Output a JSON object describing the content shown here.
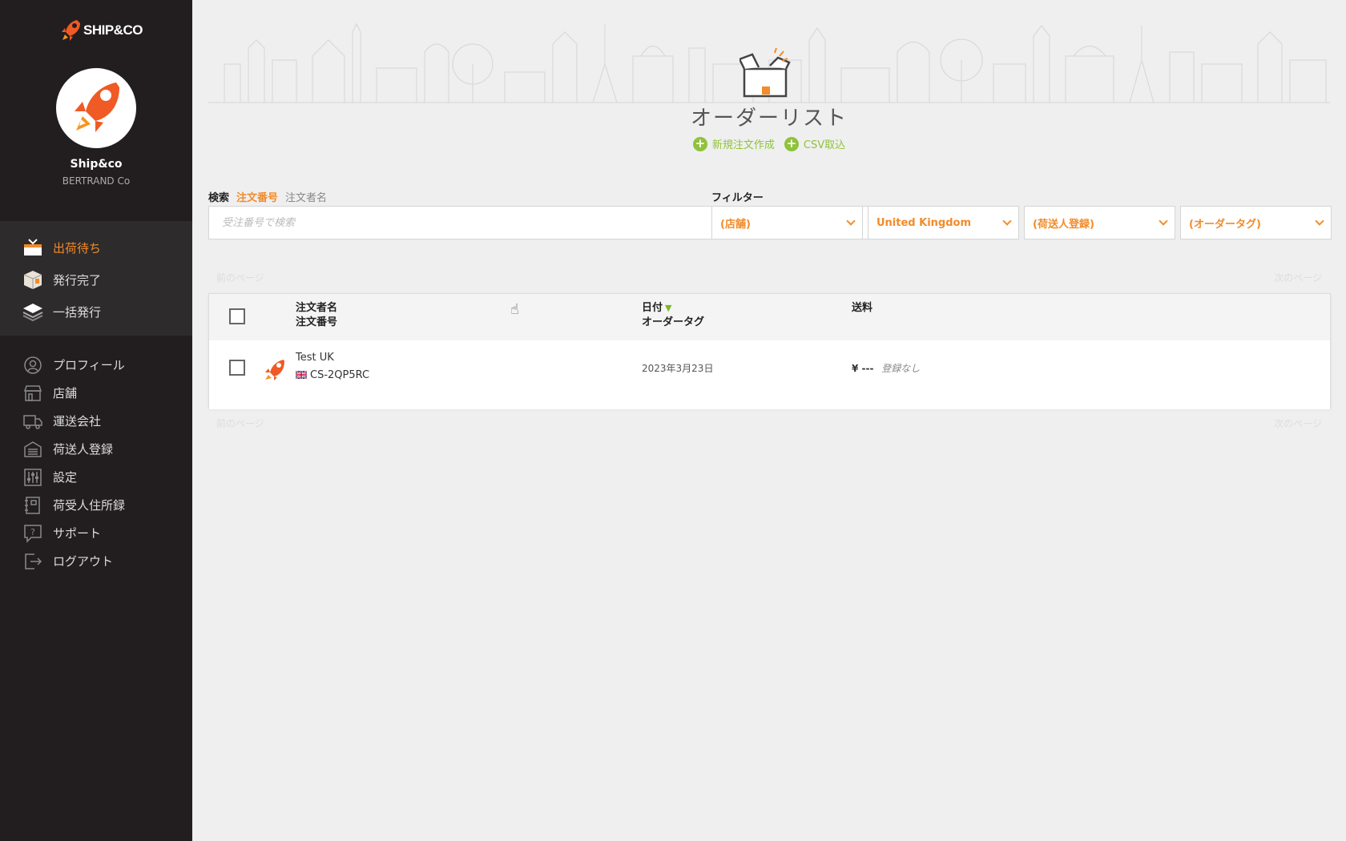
{
  "sidebar": {
    "logo_text": "SHIP&CO",
    "company_name": "Ship&co",
    "company_sub": "BERTRAND Co",
    "main_items": [
      {
        "label": "出荷待ち",
        "icon": "cart-icon",
        "active": true
      },
      {
        "label": "発行完了",
        "icon": "package-icon",
        "active": false
      },
      {
        "label": "一括発行",
        "icon": "stack-icon",
        "active": false
      }
    ],
    "secondary_items": [
      {
        "label": "プロフィール",
        "icon": "user-icon"
      },
      {
        "label": "店舗",
        "icon": "store-icon"
      },
      {
        "label": "運送会社",
        "icon": "truck-icon"
      },
      {
        "label": "荷送人登録",
        "icon": "warehouse-icon"
      },
      {
        "label": "設定",
        "icon": "sliders-icon"
      },
      {
        "label": "荷受人住所録",
        "icon": "address-book-icon"
      },
      {
        "label": "サポート",
        "icon": "help-icon"
      },
      {
        "label": "ログアウト",
        "icon": "logout-icon"
      }
    ]
  },
  "header": {
    "title": "オーダーリスト",
    "new_order": "新規注文作成",
    "csv_import": "CSV取込"
  },
  "search": {
    "label": "検索",
    "option_order_number": "注文番号",
    "option_customer_name": "注文者名",
    "placeholder": "受注番号で検索"
  },
  "filter": {
    "label": "フィルター",
    "store": "(店舗)",
    "country": "United Kingdom",
    "shipper": "(荷送人登録)",
    "order_tag": "(オーダータグ)"
  },
  "pager": {
    "prev": "前のページ",
    "next": "次のページ"
  },
  "table": {
    "col_customer": "注文者名",
    "col_order_number": "注文番号",
    "col_date": "日付",
    "col_order_tag": "オーダータグ",
    "col_shipping": "送料",
    "rows": [
      {
        "customer": "Test UK",
        "order_number": "CS-2QP5RC",
        "date": "2023年3月23日",
        "shipping": "¥ ---",
        "tag": "登録なし"
      }
    ]
  },
  "colors": {
    "accent": "#f28b2a",
    "green": "#8fc33a",
    "sidebar_bg": "#221e1f"
  }
}
